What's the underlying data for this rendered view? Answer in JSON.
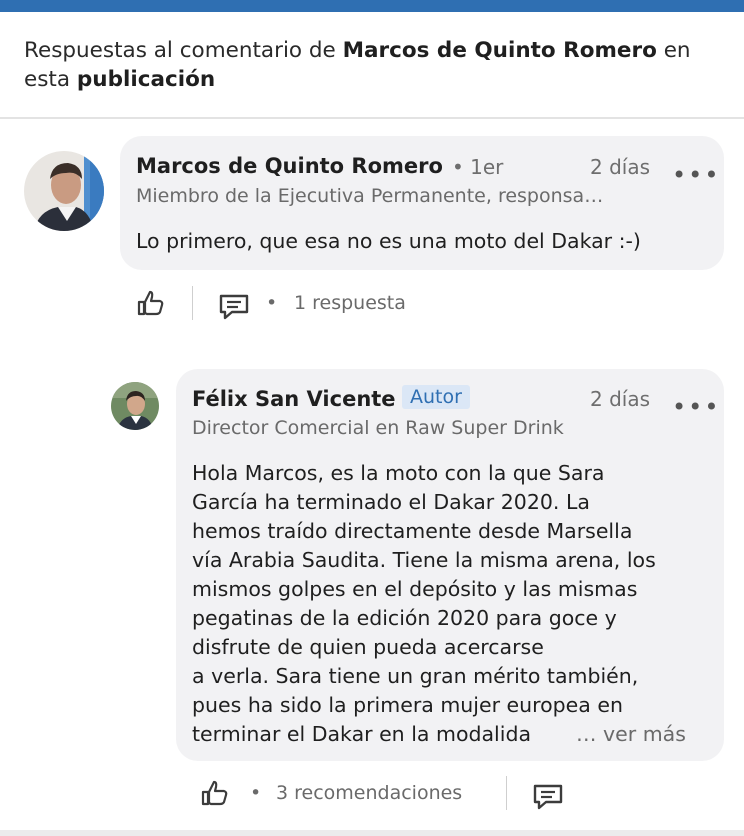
{
  "header": {
    "prefix": "Respuestas al comentario de ",
    "author": "Marcos de Quinto Romero",
    "middle": " en",
    "line2_prefix": "esta ",
    "line2_bold": "publicación"
  },
  "comment": {
    "author": "Marcos de Quinto Romero",
    "degree": "• 1er",
    "time": "2 días",
    "headline": "Miembro de la Ejecutiva Permanente, responsa…",
    "text": "Lo primero, que esa no es una moto del Dakar :-)",
    "replies_separator": "•",
    "replies_label": "1 respuesta"
  },
  "reply": {
    "author": "Félix San Vicente",
    "badge": "Autor",
    "time": "2 días",
    "headline": "Director Comercial en Raw Super Drink",
    "lines": [
      "Hola Marcos, es la moto con la que Sara",
      "García ha terminado el Dakar 2020. La",
      "hemos traído directamente desde Marsella",
      "vía Arabia Saudita. Tiene la misma arena, los",
      "mismos golpes en el depósito y las mismas",
      "pegatinas de la edición 2020 para goce y",
      "disfrute de quien pueda acercarse",
      "a verla. Sara tiene un gran mérito también,",
      "pues ha sido la primera mujer europea en",
      "terminar el Dakar en la modalida"
    ],
    "see_more": "… ver más",
    "reactions_separator": "•",
    "reactions_label": "3 recomendaciones"
  },
  "icons": {
    "like": "thumbs-up-icon",
    "comment": "comment-icon",
    "more": "ellipsis-icon"
  },
  "colors": {
    "brand": "#2f6fb2",
    "bubble": "#f2f2f4",
    "badge_bg": "#dbe7f6"
  }
}
